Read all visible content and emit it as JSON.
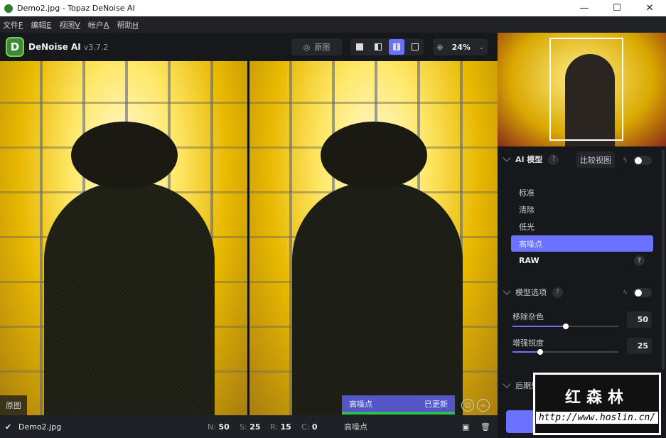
{
  "window": {
    "title": "Demo2.jpg - Topaz DeNoise AI",
    "minimize": "—",
    "maximize": "☐",
    "close": "✕"
  },
  "menu": [
    {
      "label": "文件",
      "key": "F"
    },
    {
      "label": "编辑",
      "key": "E"
    },
    {
      "label": "视图",
      "key": "V"
    },
    {
      "label": "帐户",
      "key": "A"
    },
    {
      "label": "帮助",
      "key": "H"
    }
  ],
  "toolbar": {
    "logo_letter": "D",
    "app_name": "DeNoise AI",
    "version": "v3.7.2",
    "original_label": "原图",
    "zoom": "24%"
  },
  "viewer": {
    "original_label": "原图",
    "update_model": "高噪点",
    "update_status": "已更新"
  },
  "status": {
    "file": "Demo2.jpg",
    "n_label": "N:",
    "n": "50",
    "s_label": "S:",
    "s": "25",
    "r_label": "R:",
    "r": "15",
    "c_label": "C:",
    "c": "0",
    "model": "高噪点"
  },
  "panel": {
    "ai_model": {
      "title": "AI 模型",
      "compare": "比较视图",
      "items": [
        "标准",
        "清除",
        "低光",
        "高噪点",
        "RAW"
      ],
      "selected": 3
    },
    "model_options": {
      "title": "模型选项",
      "sliders": [
        {
          "label": "移除杂色",
          "value": "50",
          "fraction": 0.5
        },
        {
          "label": "增强锐度",
          "value": "25",
          "fraction": 0.26
        }
      ]
    },
    "post": {
      "title": "后期处理"
    },
    "help": "?"
  },
  "watermark": {
    "name": "红森林",
    "url": "http://www.hoslin.cn/"
  }
}
